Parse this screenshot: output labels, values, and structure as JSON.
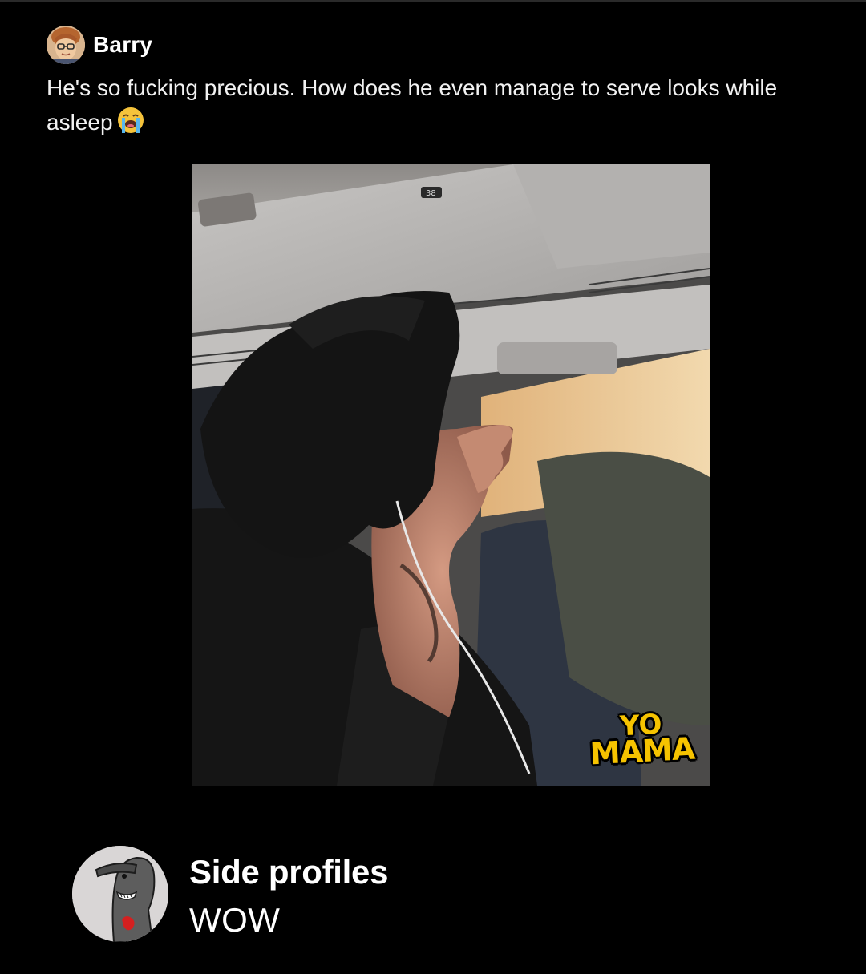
{
  "post": {
    "author": "Barry",
    "text": "He's so fucking precious. How does he even manage to serve looks while asleep",
    "emoji": "loudly-crying-face-icon"
  },
  "photo": {
    "cabin_sign": "38",
    "watermark_line1": "YO",
    "watermark_line2": "MAMA"
  },
  "comment": {
    "title": "Side profiles",
    "text": "WOW"
  }
}
